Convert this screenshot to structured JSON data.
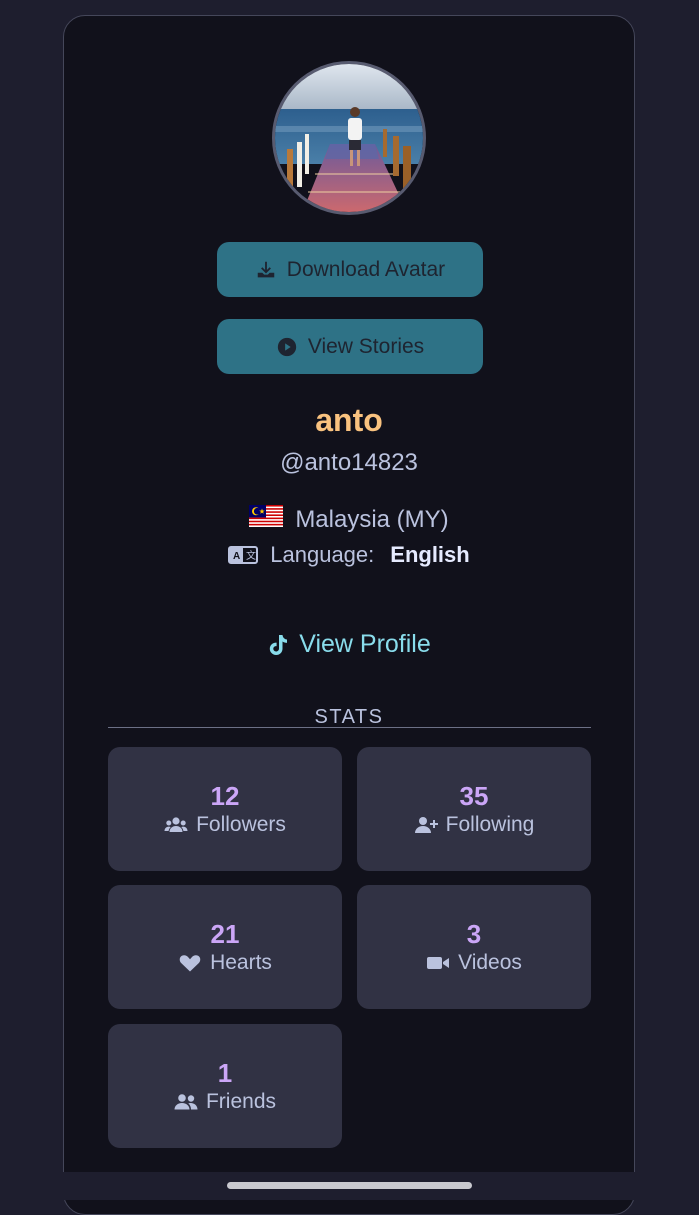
{
  "profile": {
    "display_name": "anto",
    "username": "@anto14823",
    "country_flag": "🇲🇾",
    "country": "Malaysia (MY)",
    "language_label": "Language:",
    "language_value": "English",
    "view_profile_label": "View Profile"
  },
  "buttons": {
    "download_avatar": "Download Avatar",
    "view_stories": "View Stories"
  },
  "stats": {
    "title": "STATS",
    "items": [
      {
        "value": "12",
        "label": "Followers",
        "icon": "users-icon"
      },
      {
        "value": "35",
        "label": "Following",
        "icon": "user-plus-icon"
      },
      {
        "value": "21",
        "label": "Hearts",
        "icon": "heart-icon"
      },
      {
        "value": "3",
        "label": "Videos",
        "icon": "video-icon"
      },
      {
        "value": "1",
        "label": "Friends",
        "icon": "user-group-icon"
      }
    ]
  },
  "colors": {
    "accent_name": "#f9c27f",
    "stat_value": "#cba6f7",
    "link": "#89dceb",
    "button_bg": "#2e7286"
  }
}
